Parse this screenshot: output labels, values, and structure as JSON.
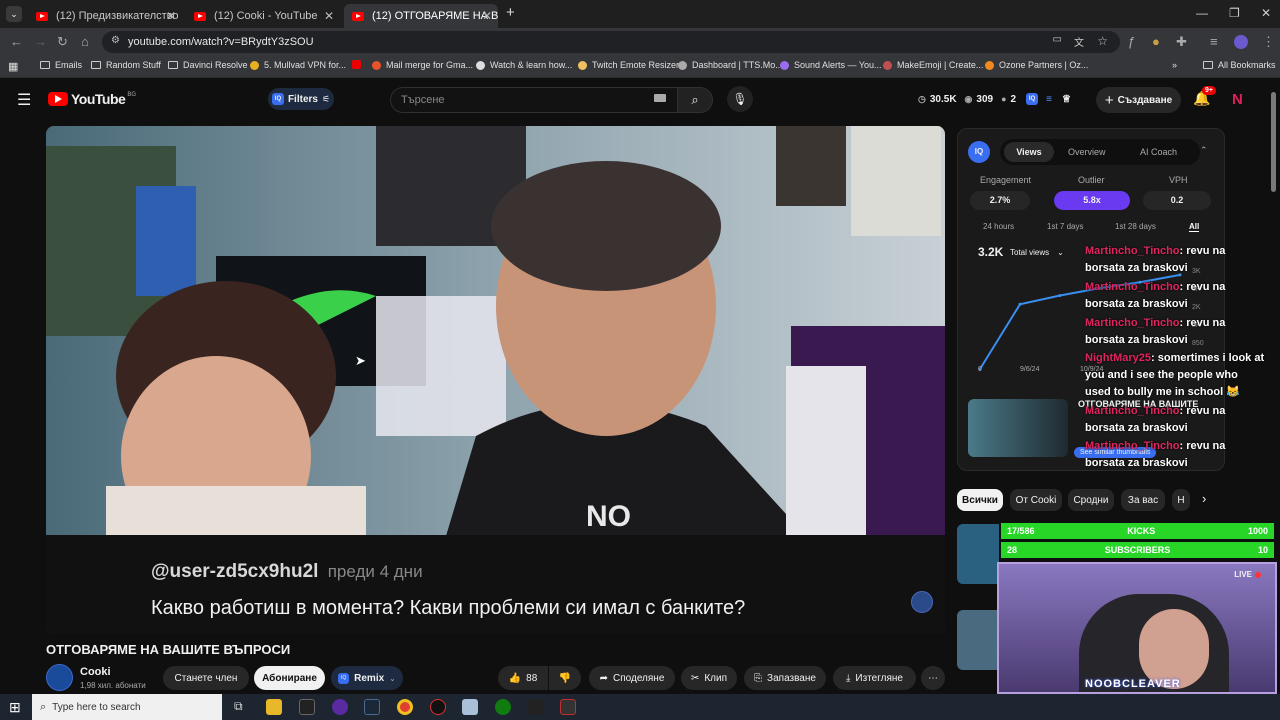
{
  "browser": {
    "tabs": [
      {
        "title": "(12) Предизвикателство - YouT"
      },
      {
        "title": "(12) Cooki - YouTube"
      },
      {
        "title": "(12) ОТГОВАРЯМЕ НА ВАШ"
      }
    ],
    "url": "youtube.com/watch?v=BRydtY3zSOU",
    "bookmarks": [
      "Emails",
      "Random Stuff",
      "Davinci Resolve",
      "5. Mullvad VPN for...",
      "Mail merge for Gma...",
      "Watch & learn how...",
      "Twitch Emote Resizer",
      "Dashboard | TTS.Mo...",
      "Sound Alerts — You...",
      "MakeEmoji | Create...",
      "Ozone Partners | Oz..."
    ],
    "all_bookmarks": "All Bookmarks"
  },
  "youtube": {
    "logo": "YouTube",
    "region": "BG",
    "filters_label": "Filters",
    "search_placeholder": "Търсене",
    "stats": {
      "subs": "30.5K",
      "views": "309",
      "count": "2"
    },
    "create_label": "Създаване",
    "notif_count": "9+",
    "avatar_letter": "N"
  },
  "video": {
    "caption_user": "@user-zd5cx9hu2l",
    "caption_time": "преди 4 дни",
    "caption_text": "Какво работиш в момента? Какви проблеми си имал с банките?",
    "title": "ОТГОВАРЯМЕ НА ВАШИТЕ ВЪПРОСИ",
    "channel": "Cooki",
    "subscribers": "1,98 хил. абонати",
    "join_label": "Станете член",
    "subscribe_label": "Абониране",
    "remix_label": "Remix",
    "likes": "88",
    "share_label": "Споделяне",
    "clip_label": "Клип",
    "save_label": "Запазване",
    "download_label": "Изтегляне"
  },
  "panel": {
    "badge": "IQ",
    "tabs": [
      "Views",
      "Overview",
      "AI Coach"
    ],
    "metric_labels": [
      "Engagement",
      "Outlier",
      "VPH"
    ],
    "metric_values": [
      "2.7%",
      "5.8x",
      "0.2"
    ],
    "ranges": [
      "24 hours",
      "1st 7 days",
      "1st 28 days",
      "All"
    ],
    "total": "3.2K",
    "total_label": "Total views",
    "y_ticks": [
      "3K",
      "3K",
      "2K",
      "2K",
      "850"
    ],
    "x_ticks": [
      "0",
      "9/6/24",
      "10/9/24"
    ],
    "similar_title": "ОТГОВАРЯМЕ НА ВАШИТЕ",
    "similar_link": "See similar thumbnails"
  },
  "chart_data": {
    "type": "line",
    "title": "",
    "xlabel": "",
    "ylabel": "",
    "x": [
      "9/6/24",
      "9/10/24",
      "9/20/24",
      "10/1/24",
      "10/9/24",
      "10/20/24"
    ],
    "values": [
      0,
      2200,
      2500,
      2750,
      2950,
      3200
    ]
  },
  "chat": [
    {
      "name": "Martincho_Tincho",
      "msg": ": revu na borsata za braskovi"
    },
    {
      "name": "Martincho_Tincho",
      "msg": ": revu na borsata za braskovi"
    },
    {
      "name": "Martincho_Tincho",
      "msg": ": revu na borsata za braskovi"
    },
    {
      "name": "NightMary25",
      "msg": ": somertimes i look at you and i see the people who used to bully me in school 😹"
    },
    {
      "name": "Martincho_Tincho",
      "msg": ": revu na borsata za braskovi"
    },
    {
      "name": "Martincho_Tincho",
      "msg": ": revu na borsata za braskovi"
    }
  ],
  "chips": [
    "Всички",
    "От Cooki",
    "Сродни",
    "За вас",
    "Н"
  ],
  "overlay": {
    "kicks_count": "17/586",
    "kicks_label": "KICKS",
    "kicks_goal": "1000",
    "subs_count": "28",
    "subs_label": "SUBSCRIBERS",
    "subs_goal": "10",
    "live": "LIVE",
    "streamer": "NOOBCLEAVER"
  },
  "taskbar": {
    "search_placeholder": "Type here to search"
  }
}
